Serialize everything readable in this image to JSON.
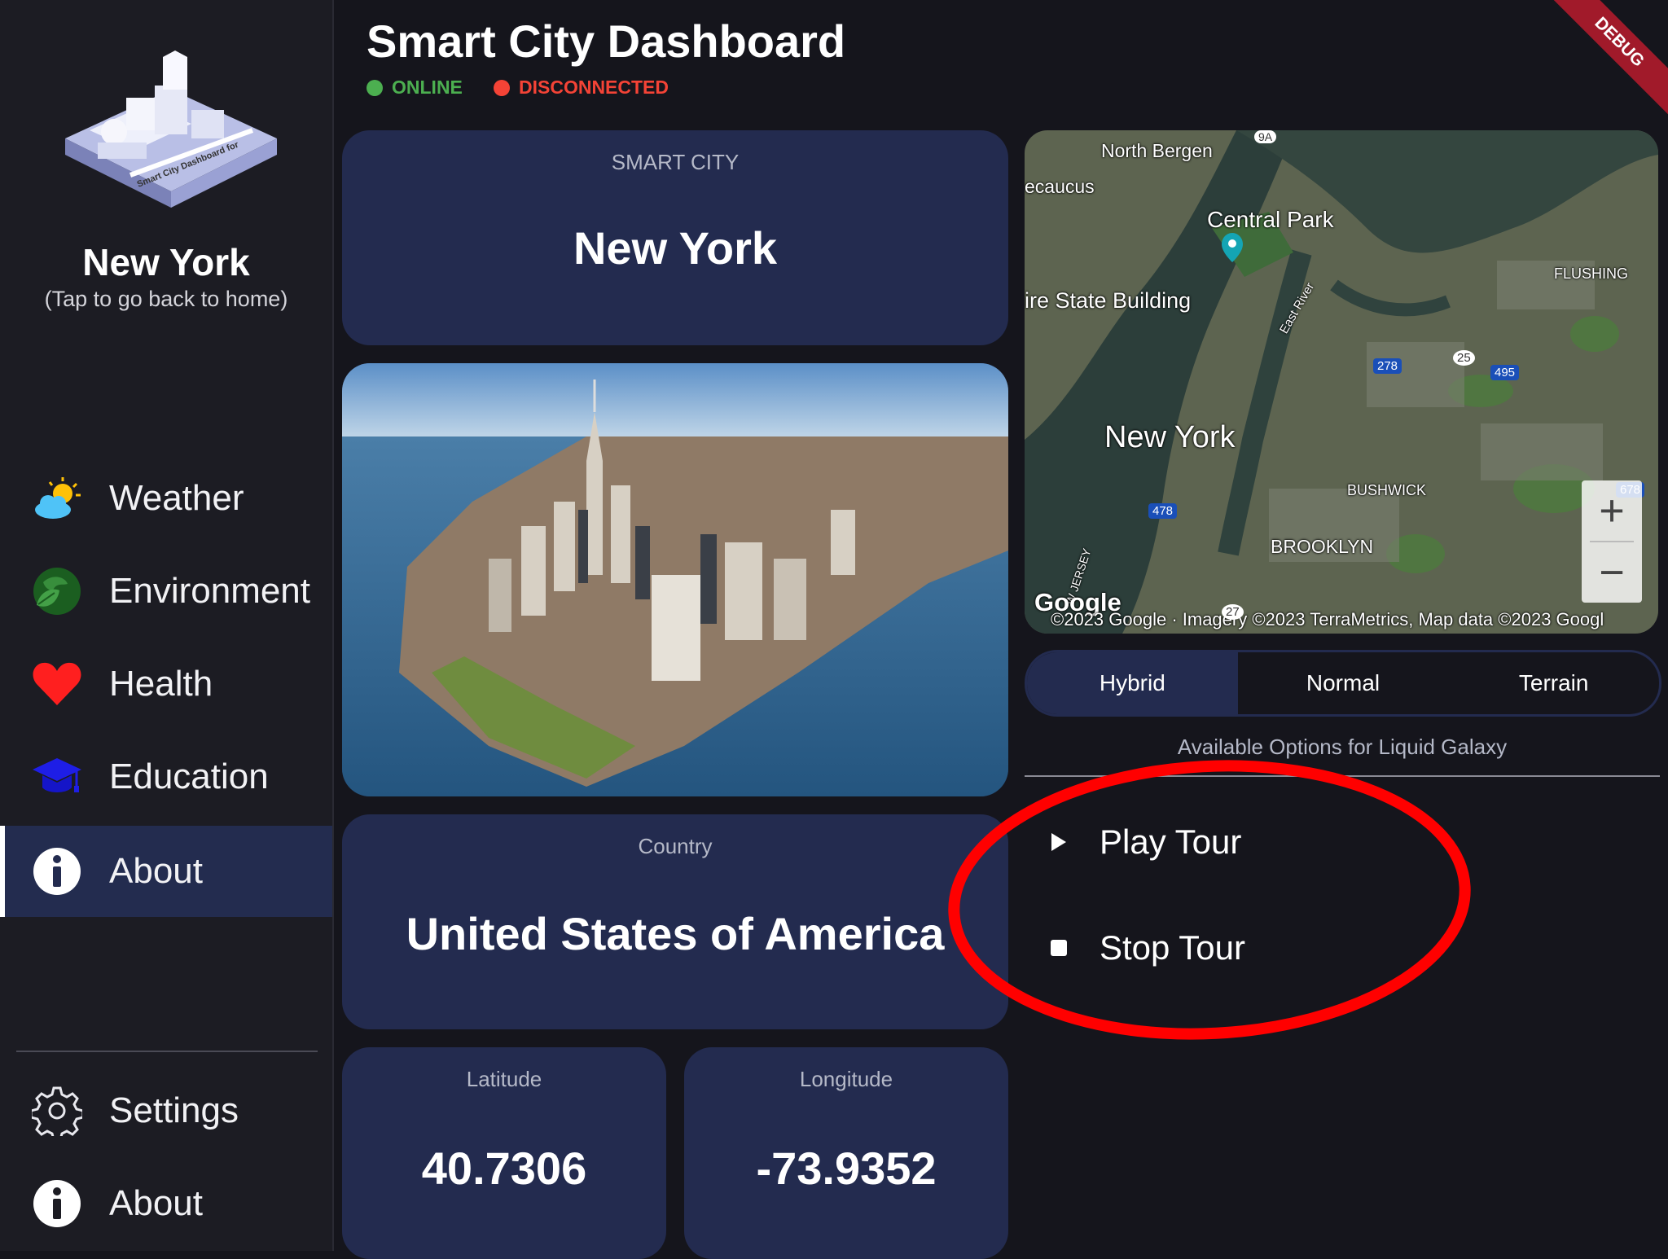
{
  "sidebar": {
    "city_name": "New York",
    "city_hint": "(Tap to go back to home)",
    "logo_text": "Smart City Dashboard for",
    "nav": [
      {
        "label": "Weather",
        "icon": "weather-icon"
      },
      {
        "label": "Environment",
        "icon": "environment-icon"
      },
      {
        "label": "Health",
        "icon": "heart-icon"
      },
      {
        "label": "Education",
        "icon": "graduation-cap-icon"
      },
      {
        "label": "About",
        "icon": "info-icon",
        "active": true
      }
    ],
    "footer_nav": [
      {
        "label": "Settings",
        "icon": "gear-icon"
      },
      {
        "label": "About",
        "icon": "info-icon"
      }
    ]
  },
  "header": {
    "title": "Smart City Dashboard",
    "status_online": "ONLINE",
    "status_disconnected": "DISCONNECTED",
    "debug_banner": "DEBUG"
  },
  "cards": {
    "city_caption": "SMART CITY",
    "city_value": "New York",
    "country_caption": "Country",
    "country_value": "United States of America",
    "latitude_caption": "Latitude",
    "latitude_value": "40.7306",
    "longitude_caption": "Longitude",
    "longitude_value": "-73.9352"
  },
  "map": {
    "labels": {
      "north_bergen": "North Bergen",
      "secaucus": "ecaucus",
      "central_park": "Central Park",
      "empire_state": "ire State Building",
      "east_river": "East River",
      "flushing": "FLUSHING",
      "new_york": "New York",
      "bushwick": "BUSHWICK",
      "brooklyn": "BROOKLYN",
      "new_jersey": "W JERSEY",
      "google": "Google",
      "attribution": "©2023 Google · Imagery ©2023 TerraMetrics, Map data ©2023 Googl"
    },
    "shields": [
      "9A",
      "278",
      "25",
      "495",
      "478",
      "678",
      "27"
    ],
    "zoom_in": "+",
    "zoom_out": "−",
    "types": [
      "Hybrid",
      "Normal",
      "Terrain"
    ],
    "selected_type": "Hybrid"
  },
  "options": {
    "title": "Available Options for Liquid Galaxy",
    "play_label": "Play Tour",
    "stop_label": "Stop Tour"
  },
  "colors": {
    "background": "#15151c",
    "sidebar": "#1c1c23",
    "card": "#232b4f",
    "online": "#4caf50",
    "disconnected": "#f44336",
    "highlight_ellipse": "#ff0000"
  }
}
